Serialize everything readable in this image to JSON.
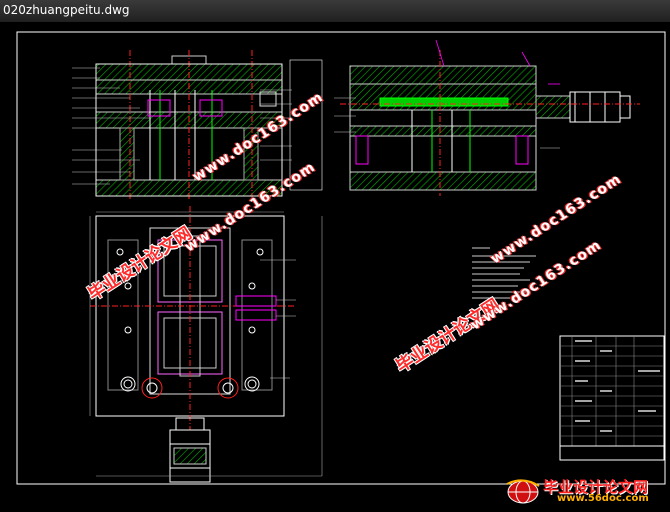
{
  "window": {
    "title": "020zhuangpeitu.dwg"
  },
  "colors": {
    "background": "#000000",
    "frame": "#ffffff",
    "hatch": "#00c000",
    "centerline": "#ff2020",
    "accent": "#ff00ff"
  },
  "watermarks": [
    {
      "cn": "毕业设计论文网",
      "url": "www.doc163.com"
    },
    {
      "cn": "毕业设计论文网",
      "url": "www.doc163.com"
    },
    {
      "cn": "毕业设计论文网",
      "url": "www.doc163.com"
    }
  ],
  "logo": {
    "cn": "毕业设计论文网",
    "url": "www.56doc.com",
    "icon": "globe-icon"
  }
}
